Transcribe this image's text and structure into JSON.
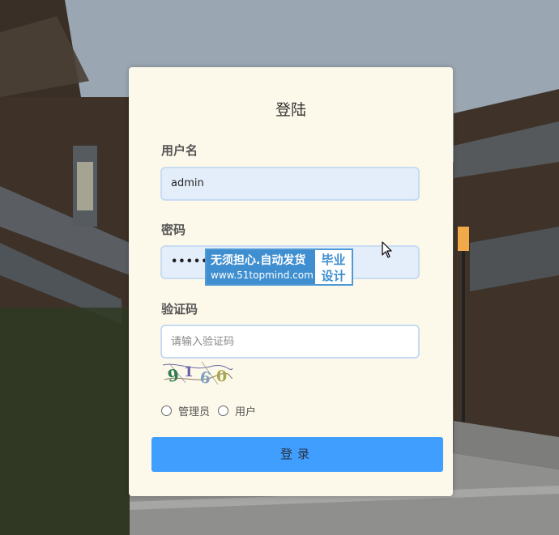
{
  "login": {
    "title": "登陆",
    "username_label": "用户名",
    "username_value": "admin",
    "password_label": "密码",
    "password_value": "•••••",
    "captcha_label": "验证码",
    "captcha_placeholder": "请输入验证码",
    "captcha_text": "9160",
    "roles": [
      {
        "label": "管理员",
        "selected": false
      },
      {
        "label": "用户",
        "selected": false
      }
    ],
    "login_button": "登录"
  },
  "watermark": {
    "line1": "无须担心.自动发货",
    "line2": "www.51topmind.com",
    "side_line1": "毕业",
    "side_line2": "设计"
  },
  "colors": {
    "card_bg": "#fdf9ea",
    "input_filled_bg": "#e4eefb",
    "button_bg": "#409eff",
    "watermark_blue": "#3f8fd0"
  }
}
